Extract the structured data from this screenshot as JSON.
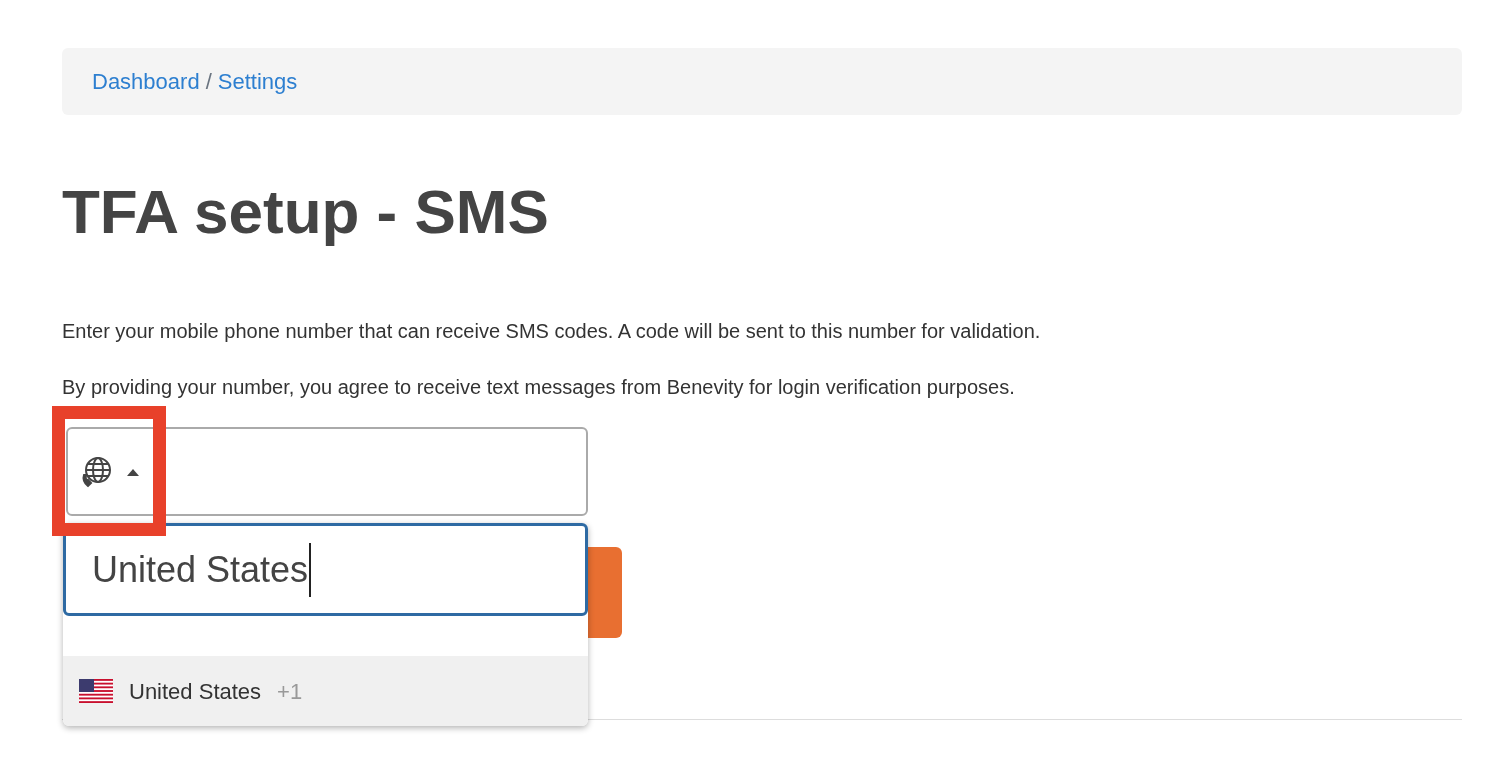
{
  "breadcrumb": [
    {
      "label": "Dashboard"
    },
    {
      "label": "Settings"
    }
  ],
  "breadcrumb_separator": "/",
  "title": "TFA setup - SMS",
  "paragraphs": [
    "Enter your mobile phone number that can receive SMS codes. A code will be sent to this number for validation.",
    "By providing your number, you agree to receive text messages from Benevity for login verification purposes."
  ],
  "phone_field": {
    "country_menu_expanded": true
  },
  "country_dropdown": {
    "search_value": "United States",
    "options": [
      {
        "name": "United States",
        "dial_code": "+1",
        "selected": true
      }
    ]
  },
  "annotation": {
    "highlight_box": true
  }
}
